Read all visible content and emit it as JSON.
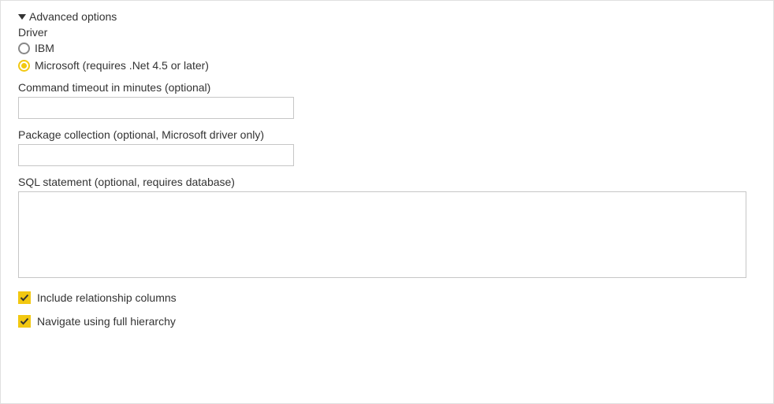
{
  "expander": {
    "title": "Advanced options"
  },
  "driver": {
    "label": "Driver",
    "options": {
      "ibm": "IBM",
      "microsoft": "Microsoft (requires .Net 4.5 or later)"
    },
    "selected": "microsoft"
  },
  "fields": {
    "timeout": {
      "label": "Command timeout in minutes (optional)",
      "value": ""
    },
    "package": {
      "label": "Package collection (optional, Microsoft driver only)",
      "value": ""
    },
    "sql": {
      "label": "SQL statement (optional, requires database)",
      "value": ""
    }
  },
  "checkboxes": {
    "relationship": {
      "label": "Include relationship columns",
      "checked": true
    },
    "hierarchy": {
      "label": "Navigate using full hierarchy",
      "checked": true
    }
  }
}
